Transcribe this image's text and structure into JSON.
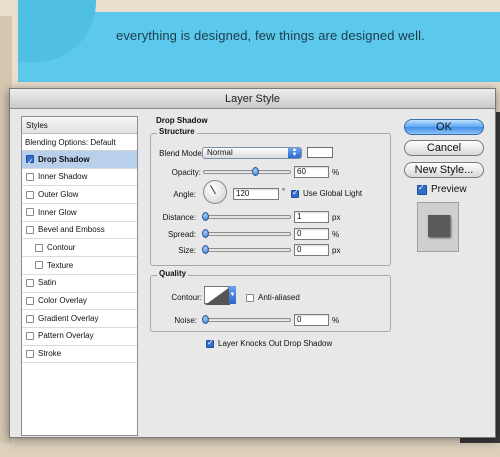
{
  "background": {
    "tagline": "everything is designed, few things are designed well."
  },
  "dialog": {
    "title": "Layer Style",
    "styles_header": "Styles",
    "blending_options": "Blending Options: Default",
    "styles": [
      {
        "label": "Drop Shadow",
        "checked": true,
        "selected": true
      },
      {
        "label": "Inner Shadow",
        "checked": false
      },
      {
        "label": "Outer Glow",
        "checked": false
      },
      {
        "label": "Inner Glow",
        "checked": false
      },
      {
        "label": "Bevel and Emboss",
        "checked": false
      },
      {
        "label": "Contour",
        "checked": false,
        "sub": true
      },
      {
        "label": "Texture",
        "checked": false,
        "sub": true
      },
      {
        "label": "Satin",
        "checked": false
      },
      {
        "label": "Color Overlay",
        "checked": false
      },
      {
        "label": "Gradient Overlay",
        "checked": false
      },
      {
        "label": "Pattern Overlay",
        "checked": false
      },
      {
        "label": "Stroke",
        "checked": false
      }
    ],
    "section_title": "Drop Shadow",
    "structure": {
      "title": "Structure",
      "blend_mode_label": "Blend Mode:",
      "blend_mode_value": "Normal",
      "opacity_label": "Opacity:",
      "opacity_value": "60",
      "opacity_unit": "%",
      "opacity_fraction": 0.6,
      "angle_label": "Angle:",
      "angle_value": "120",
      "angle_unit": "°",
      "use_global_light_label": "Use Global Light",
      "use_global_light": true,
      "distance_label": "Distance:",
      "distance_value": "1",
      "distance_unit": "px",
      "spread_label": "Spread:",
      "spread_value": "0",
      "spread_unit": "%",
      "size_label": "Size:",
      "size_value": "0",
      "size_unit": "px"
    },
    "quality": {
      "title": "Quality",
      "contour_label": "Contour:",
      "anti_aliased_label": "Anti-aliased",
      "anti_aliased": false,
      "noise_label": "Noise:",
      "noise_value": "0",
      "noise_unit": "%"
    },
    "knockout_label": "Layer Knocks Out Drop Shadow",
    "knockout": true,
    "buttons": {
      "ok": "OK",
      "cancel": "Cancel",
      "new_style": "New Style..."
    },
    "preview_label": "Preview",
    "preview_checked": true
  }
}
